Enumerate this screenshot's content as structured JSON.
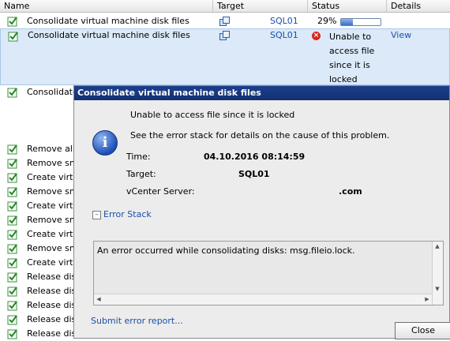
{
  "columns": {
    "name": "Name",
    "target": "Target",
    "status": "Status",
    "details": "Details"
  },
  "tasks": [
    {
      "name": "Consolidate virtual machine disk files",
      "target": "SQL01",
      "status": "29%",
      "progress": 0.29,
      "details": ""
    },
    {
      "name": "Consolidate virtual machine disk files",
      "target": "SQL01",
      "status_lines": [
        "Unable to",
        "access file",
        "since it is",
        "locked"
      ],
      "details": "View"
    },
    {
      "name": "Consolidate"
    },
    {
      "name": "Remove all s"
    },
    {
      "name": "Remove sna"
    },
    {
      "name": "Create virtu"
    },
    {
      "name": "Remove sna"
    },
    {
      "name": "Create virtu"
    },
    {
      "name": "Remove sna"
    },
    {
      "name": "Create virtu"
    },
    {
      "name": "Remove sna"
    },
    {
      "name": "Create virtu"
    },
    {
      "name": "Release disk"
    },
    {
      "name": "Release disk"
    },
    {
      "name": "Release disk"
    },
    {
      "name": "Release disk"
    },
    {
      "name": "Release disk"
    }
  ],
  "dialog": {
    "title": "Consolidate virtual machine disk files",
    "message": "Unable to access file  since it is locked",
    "submessage": "See the error stack for details on the cause of this problem.",
    "time_label": "Time:",
    "time_value": "04.10.2016 08:14:59",
    "target_label": "Target:",
    "target_value": "SQL01",
    "vcenter_label": "vCenter Server:",
    "vcenter_value": ".com",
    "error_stack_label": "Error Stack",
    "error_stack_text": "An error occurred while consolidating disks: msg.fileio.lock.",
    "submit_link": "Submit error report...",
    "close_label": "Close"
  },
  "colors": {
    "title_bar": "#173a80",
    "link": "#1a4fa8",
    "error": "#d9251d",
    "selection": "#dbe9f8"
  },
  "icons": [
    "task-success-icon",
    "vm-icon",
    "error-icon",
    "info-icon",
    "collapse-icon"
  ]
}
